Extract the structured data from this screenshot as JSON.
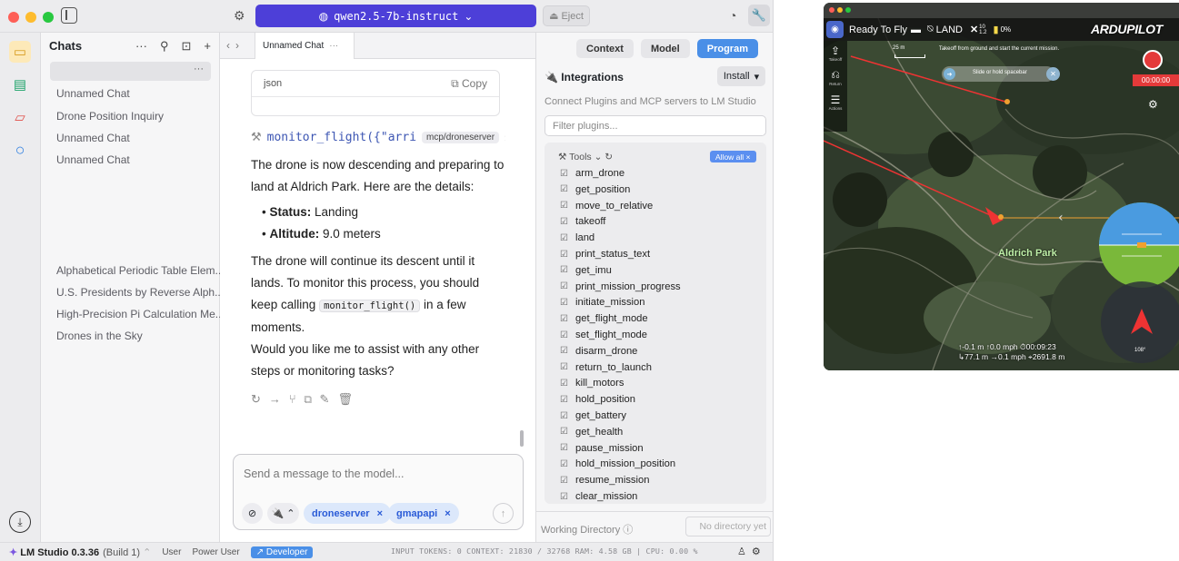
{
  "lm": {
    "model_name": "qwen2.5-7b-instruct",
    "eject_label": "Eject",
    "chats": {
      "title": "Chats",
      "selected_menu": "···",
      "items": [
        "Unnamed Chat",
        "Drone Position Inquiry",
        "Unnamed Chat",
        "Unnamed Chat"
      ],
      "old_items": [
        "Alphabetical Periodic Table Elem...",
        "U.S. Presidents by Reverse Alph...",
        "High-Precision Pi Calculation Me...",
        "Drones in the Sky"
      ]
    },
    "tab": {
      "label": "Unnamed Chat",
      "menu": "···"
    },
    "message": {
      "code_lang": "json",
      "copy_label": "Copy",
      "tool_call": "monitor_flight({\"arri",
      "tool_server": "mcp/droneserver",
      "p1": "The drone is now descending and preparing to land at Aldrich Park. Here are the details:",
      "b1_label": "Status:",
      "b1_value": " Landing",
      "b2_label": "Altitude:",
      "b2_value": " 9.0 meters",
      "p2_before": "The drone will continue its descent until it lands. To monitor this process, you should keep calling ",
      "p2_code": "monitor_flight()",
      "p2_after": " in a few moments.",
      "p3": "Would you like me to assist with any other steps or monitoring tasks?"
    },
    "composer": {
      "placeholder": "Send a message to the model...",
      "chips": [
        "droneserver",
        "gmapapi"
      ]
    },
    "right_panel": {
      "tabs": [
        "Context",
        "Model",
        "Program"
      ],
      "active_tab": "Program",
      "integrations_title": "Integrations",
      "install_label": "Install",
      "description": "Connect Plugins and MCP servers to LM Studio",
      "filter_placeholder": "Filter plugins...",
      "tools_label": "Tools",
      "allow_all_label": "Allow all",
      "tools": [
        "arm_drone",
        "get_position",
        "move_to_relative",
        "takeoff",
        "land",
        "print_status_text",
        "get_imu",
        "print_mission_progress",
        "initiate_mission",
        "get_flight_mode",
        "set_flight_mode",
        "disarm_drone",
        "return_to_launch",
        "kill_motors",
        "hold_position",
        "get_battery",
        "get_health",
        "pause_mission",
        "hold_mission_position",
        "resume_mission",
        "clear_mission"
      ],
      "working_dir_label": "Working Directory",
      "working_dir_value": "No directory yet"
    },
    "status_bar": {
      "app_name": "LM Studio 0.3.36",
      "build": "(Build 1)",
      "modes": [
        "User",
        "Power User",
        "Developer"
      ],
      "active_mode": "Developer",
      "stats": "INPUT TOKENS: 0    CONTEXT: 21830 / 32768    RAM: 4.58 GB | CPU: 0.00 %"
    }
  },
  "drone": {
    "status": "Ready To Fly",
    "mode": "LAND",
    "satellites": "10",
    "hdop": "1.2",
    "battery": "0%",
    "brand": "ARDUPILOT",
    "side_buttons": [
      "Takeoff",
      "Return",
      "Actions"
    ],
    "scale_label": "25 m",
    "takeoff_hint": "Takeoff from ground and start the current mission.",
    "slider_text": "Slide or hold spacebar",
    "record_time": "00:00:00",
    "park_name": "Aldrich Park",
    "compass_heading": "108°",
    "telemetry_line1": "↑-0.1 m  ↑0.0 mph  ⏱00:09:23",
    "telemetry_line2": "↳77.1 m  →0.1 mph  ⌖2691.8 m"
  }
}
